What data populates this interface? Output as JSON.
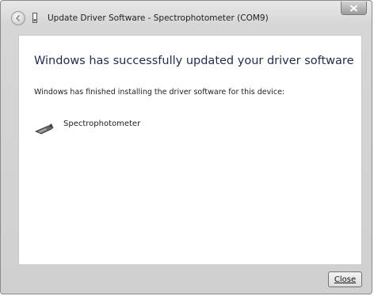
{
  "window": {
    "title": "Update Driver Software - Spectrophotometer (COM9)"
  },
  "content": {
    "headline": "Windows has successfully updated your driver software",
    "subtext": "Windows has finished installing the driver software for this device:",
    "device_name": "Spectrophotometer"
  },
  "footer": {
    "close_label": "Close"
  },
  "icons": {
    "back": "back-arrow-icon",
    "app": "driver-icon",
    "close": "close-x-icon",
    "device": "spectrophotometer-device-icon"
  }
}
